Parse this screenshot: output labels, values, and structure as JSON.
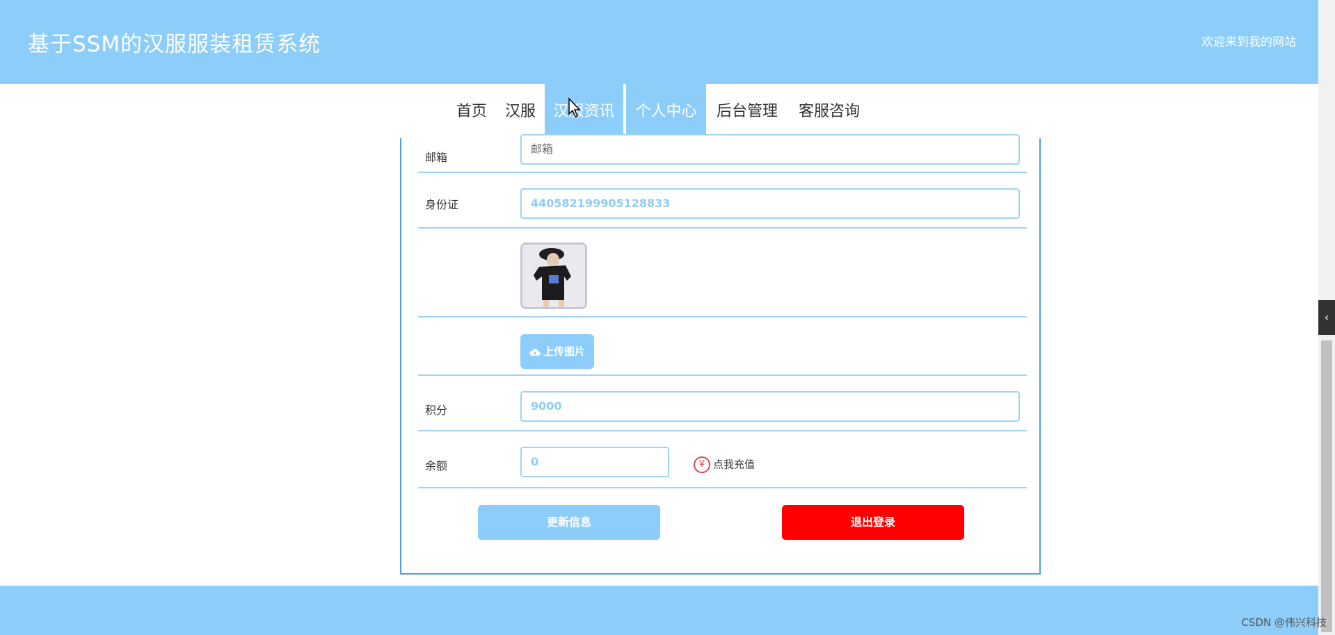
{
  "header": {
    "site_title": "基于SSM的汉服服装租赁系统",
    "welcome": "欢迎来到我的网站"
  },
  "nav": {
    "items": [
      {
        "label": "首页",
        "active": false
      },
      {
        "label": "汉服",
        "active": false
      },
      {
        "label": "汉服资讯",
        "active": true
      },
      {
        "label": "个人中心",
        "active": true
      },
      {
        "label": "后台管理",
        "active": false
      },
      {
        "label": "客服咨询",
        "active": false
      }
    ]
  },
  "form": {
    "email": {
      "label": "邮箱",
      "value": "邮箱"
    },
    "id_card": {
      "label": "身份证",
      "value": "440582199905128833"
    },
    "avatar_icon": "user-photo",
    "upload_button": "上传图片",
    "points": {
      "label": "积分",
      "value": "9000"
    },
    "balance": {
      "label": "余额",
      "value": "0"
    },
    "recharge_link": "点我充值",
    "update_button": "更新信息",
    "logout_button": "退出登录"
  },
  "colors": {
    "primary": "#8ccdfa",
    "danger": "#ff0000",
    "border": "#9fd4f3"
  },
  "watermark": "CSDN @伟兴科技"
}
